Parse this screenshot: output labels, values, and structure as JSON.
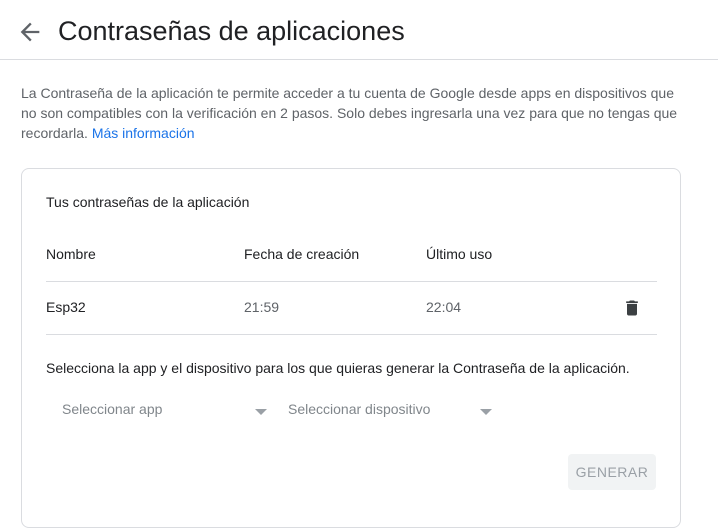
{
  "header": {
    "back_icon": "arrow-back-icon",
    "title": "Contraseñas de aplicaciones"
  },
  "intro": {
    "text": "La Contraseña de la aplicación te permite acceder a tu cuenta de Google desde apps en dispositivos que no son compatibles con la verificación en 2 pasos. Solo debes ingresarla una vez para que no tengas que recordarla. ",
    "link": "Más información"
  },
  "card": {
    "title": "Tus contraseñas de la aplicación",
    "columns": {
      "name": "Nombre",
      "created": "Fecha de creación",
      "last_used": "Último uso"
    },
    "rows": [
      {
        "name": "Esp32",
        "created": "21:59",
        "last_used": "22:04",
        "delete_icon": "trash-icon"
      }
    ],
    "instructions": "Selecciona la app y el dispositivo para los que quieras generar la Contraseña de la aplicación.",
    "select_app": "Seleccionar app",
    "select_device": "Seleccionar dispositivo",
    "generate": "GENERAR"
  },
  "colors": {
    "link": "#1a73e8",
    "text": "#202124",
    "muted": "#5f6368",
    "divider": "#dadce0"
  }
}
